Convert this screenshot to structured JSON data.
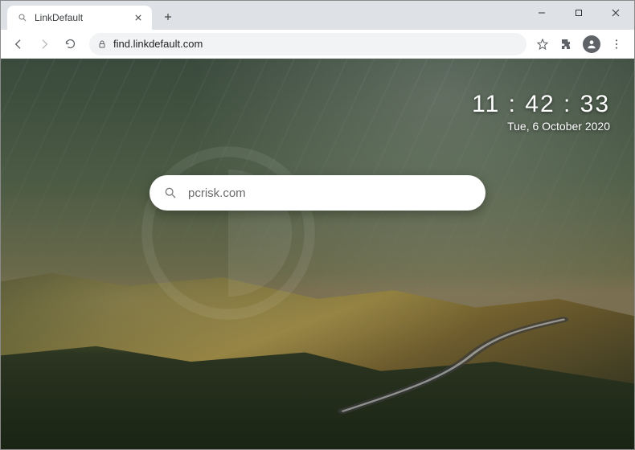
{
  "window": {
    "tab_title": "LinkDefault"
  },
  "toolbar": {
    "url": "find.linkdefault.com"
  },
  "page": {
    "search_value": "pcrisk.com",
    "clock_time": "11 : 42 : 33",
    "clock_date": "Tue, 6 October 2020"
  }
}
